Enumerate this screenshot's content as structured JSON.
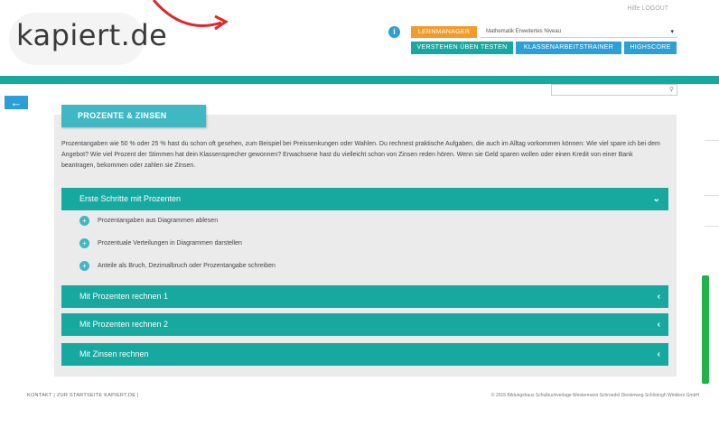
{
  "header": {
    "logo_text": "kapiert.de",
    "top_links": "Hilfe  LOGOUT",
    "info_icon": "i",
    "lernmanager_label": "LERNMANAGER",
    "level_selected": "Mathematik Erweitertes Niveau",
    "nav": [
      "VERSTEHEN ÜBEN TESTEN",
      "KLASSENARBEITSTRAINER",
      "HIGHSCORE"
    ]
  },
  "back_icon": "←",
  "search": {
    "placeholder": "",
    "icon": "search-icon"
  },
  "topic": {
    "title": "PROZENTE & ZINSEN",
    "intro": "Prozentangaben wie 50 % oder 25 % hast du schon oft gesehen, zum Beispiel bei Preissenkungen oder Wahlen. Du rechnest praktische Aufgaben, die auch im Alltag vorkommen können: Wie viel spare ich bei dem Angebot? Wie viel Prozent der Stimmen hat dein Klassensprecher gewonnen? Erwachsene hast du vielleicht schon von Zinsen reden hören. Wenn sie Geld sparen wollen oder einen Kredit von einer Bank beantragen, bekommen oder zahlen sie Zinsen."
  },
  "sections": [
    {
      "title": "Erste Schritte mit Prozenten",
      "expanded": true,
      "items": [
        "Prozentangaben aus Diagrammen ablesen",
        "Prozentuale Verteilungen in Diagrammen darstellen",
        "Anteile als Bruch, Dezimalbruch oder Prozentangabe schreiben"
      ]
    },
    {
      "title": "Mit Prozenten rechnen 1",
      "expanded": false
    },
    {
      "title": "Mit Prozenten rechnen 2",
      "expanded": false
    },
    {
      "title": "Mit Zinsen rechnen",
      "expanded": false
    }
  ],
  "chevrons": {
    "expanded": "⌄",
    "collapsed": "‹"
  },
  "footer": {
    "links": "KONTAKT  |  ZUR STARTSEITE KAPIERT.DE  |",
    "copyright": "© 2015 Bildungshaus Schulbuchverlage Westermann Schroedel Diesterweg Schöningh Winklers GmbH"
  },
  "colors": {
    "teal": "#17a9a0",
    "blue": "#2b9fd6",
    "orange": "#f39a2b",
    "green": "#21b24b"
  }
}
